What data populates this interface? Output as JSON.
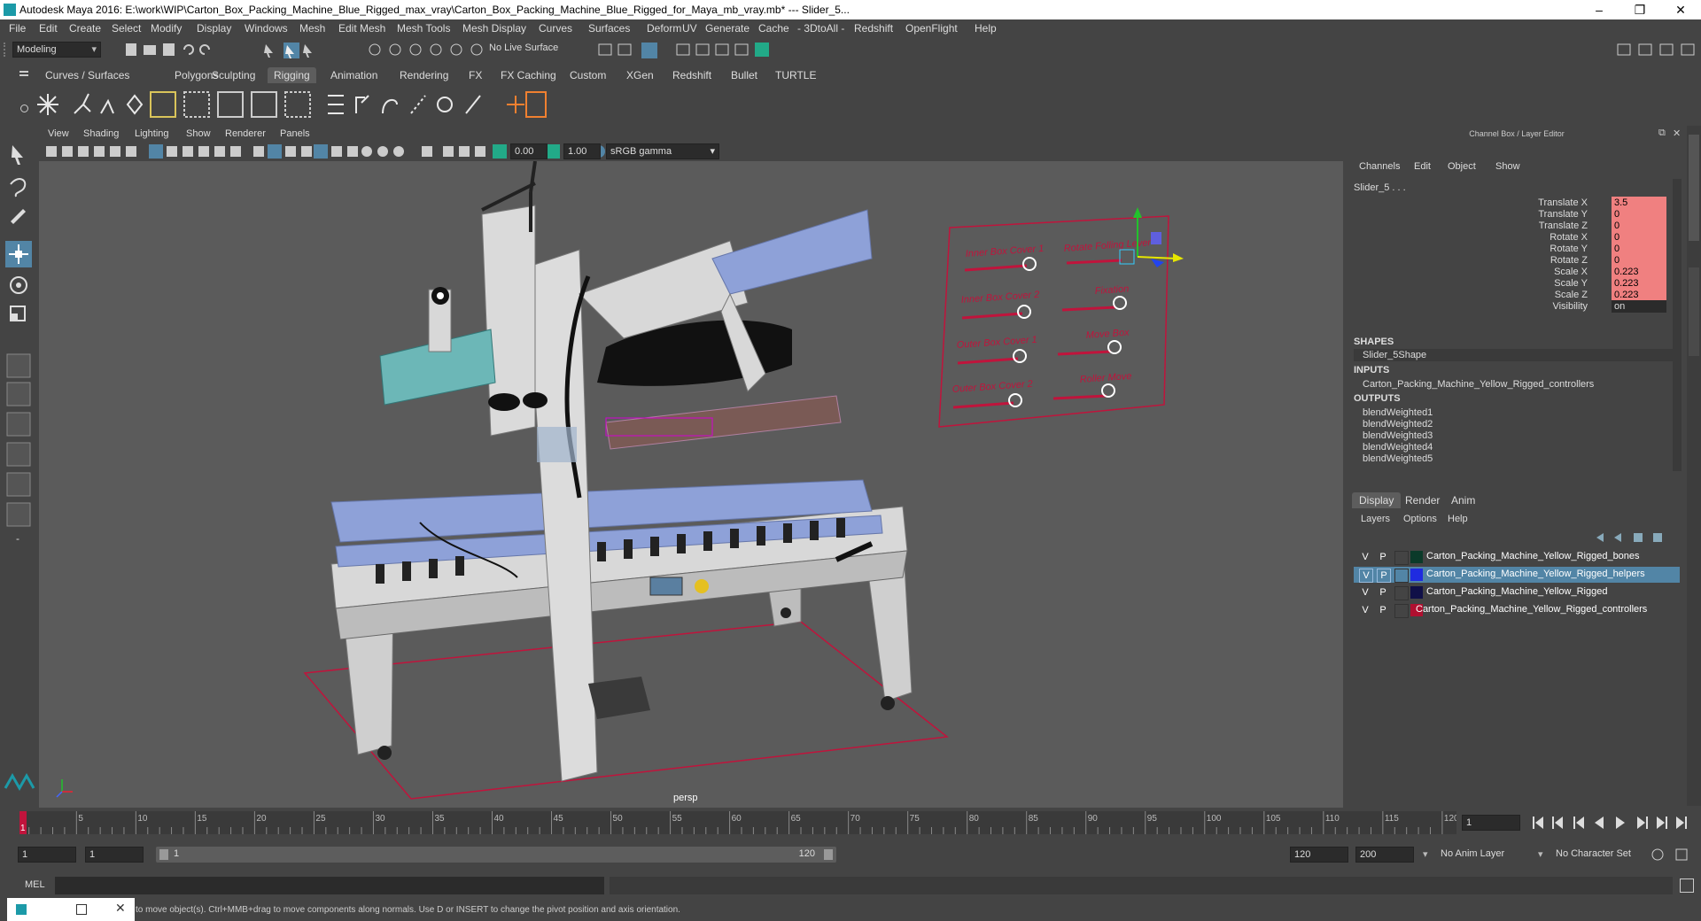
{
  "window": {
    "title": "Autodesk Maya 2016: E:\\work\\WIP\\Carton_Box_Packing_Machine_Blue_Rigged_max_vray\\Carton_Box_Packing_Machine_Blue_Rigged_for_Maya_mb_vray.mb*   ---   Slider_5...",
    "minimize": "–",
    "maximize": "❐",
    "close": "✕"
  },
  "menubar": [
    "File",
    "Edit",
    "Create",
    "Select",
    "Modify",
    "Display",
    "Windows",
    "Mesh",
    "Edit Mesh",
    "Mesh Tools",
    "Mesh Display",
    "Curves",
    "Surfaces",
    "Deform",
    "UV",
    "Generate",
    "Cache",
    "- 3DtoAll -",
    "Redshift",
    "OpenFlight",
    "Help"
  ],
  "statusline": {
    "mode": "Modeling",
    "live_surface": "No Live Surface"
  },
  "shelf": {
    "tabs": [
      "Curves / Surfaces",
      "Polygons",
      "Sculpting",
      "Rigging",
      "Animation",
      "Rendering",
      "FX",
      "FX Caching",
      "Custom",
      "XGen",
      "Redshift",
      "Bullet",
      "TURTLE"
    ],
    "active_tab": "Rigging"
  },
  "viewport": {
    "menus": [
      "View",
      "Shading",
      "Lighting",
      "Show",
      "Renderer",
      "Panels"
    ],
    "exposure": "0.00",
    "gamma": "1.00",
    "color_space": "sRGB gamma",
    "camera_label": "persp",
    "slider_panel_labels": [
      "Inner Box Cover 1",
      "Inner Box Cover 2",
      "Outer Box Cover 1",
      "Outer Box Cover 2",
      "Rotate Folling Lever",
      "Fixation",
      "Move Box",
      "Roller Move"
    ]
  },
  "channelbox": {
    "header": "Channel Box / Layer Editor",
    "menus": [
      "Channels",
      "Edit",
      "Object",
      "Show"
    ],
    "object_name": "Slider_5 . . .",
    "channels": [
      {
        "label": "Translate X",
        "value": "3.5",
        "color": "#f08080"
      },
      {
        "label": "Translate Y",
        "value": "0",
        "color": "#f08080"
      },
      {
        "label": "Translate Z",
        "value": "0",
        "color": "#f08080"
      },
      {
        "label": "Rotate X",
        "value": "0",
        "color": "#f08080"
      },
      {
        "label": "Rotate Y",
        "value": "0",
        "color": "#f08080"
      },
      {
        "label": "Rotate Z",
        "value": "0",
        "color": "#f08080"
      },
      {
        "label": "Scale X",
        "value": "0.223",
        "color": "#f08080"
      },
      {
        "label": "Scale Y",
        "value": "0.223",
        "color": "#f08080"
      },
      {
        "label": "Scale Z",
        "value": "0.223",
        "color": "#f08080"
      },
      {
        "label": "Visibility",
        "value": "on",
        "color": "#2b2b2b"
      }
    ],
    "shapes_title": "SHAPES",
    "shapes": [
      "Slider_5Shape"
    ],
    "inputs_title": "INPUTS",
    "inputs": [
      "Carton_Packing_Machine_Yellow_Rigged_controllers"
    ],
    "outputs_title": "OUTPUTS",
    "outputs": [
      "blendWeighted1",
      "blendWeighted2",
      "blendWeighted3",
      "blendWeighted4",
      "blendWeighted5"
    ]
  },
  "layereditor": {
    "tabs": [
      "Display",
      "Render",
      "Anim"
    ],
    "active_tab": "Display",
    "menus": [
      "Layers",
      "Options",
      "Help"
    ],
    "layers": [
      {
        "v": "V",
        "p": "P",
        "name": "Carton_Packing_Machine_Yellow_Rigged_bones",
        "color": "#0b3a2a",
        "selected": false
      },
      {
        "v": "V",
        "p": "P",
        "name": "Carton_Packing_Machine_Yellow_Rigged_helpers",
        "color": "#1f2be0",
        "selected": true
      },
      {
        "v": "V",
        "p": "P",
        "name": "Carton_Packing_Machine_Yellow_Rigged",
        "color": "#101048",
        "selected": false
      },
      {
        "v": "V",
        "p": "P",
        "name": "Carton_Packing_Machine_Yellow_Rigged_controllers",
        "color": "#b01030",
        "selected": false
      }
    ]
  },
  "timeline": {
    "ticks": [
      "5",
      "10",
      "15",
      "20",
      "25",
      "30",
      "35",
      "40",
      "45",
      "50",
      "55",
      "60",
      "65",
      "70",
      "75",
      "80",
      "85",
      "90",
      "95",
      "100",
      "105",
      "110",
      "115",
      "120"
    ],
    "current_frame": "1",
    "current_field": "1"
  },
  "range": {
    "start": "1",
    "start2": "1",
    "inner_start": "1",
    "inner_end": "120",
    "end": "120",
    "end2": "200",
    "anim_layer": "No Anim Layer",
    "char_set": "No Character Set"
  },
  "cmdline": {
    "label": "MEL"
  },
  "helpline": {
    "text": "to move object(s). Ctrl+MMB+drag to move components along normals. Use D or INSERT to change the pivot position and axis orientation."
  }
}
